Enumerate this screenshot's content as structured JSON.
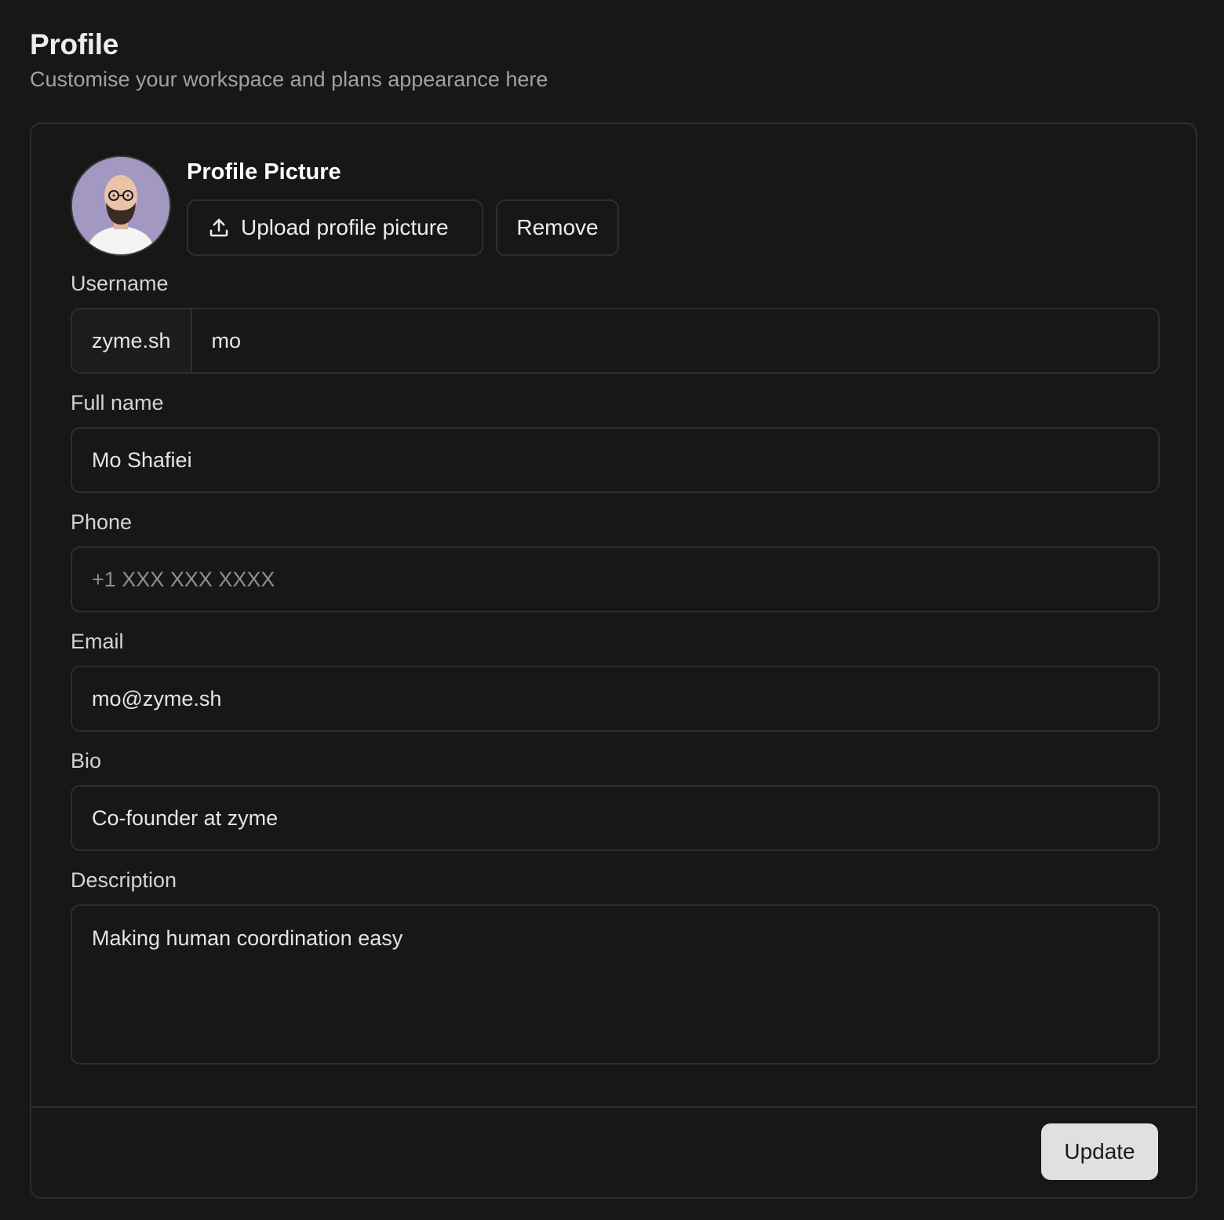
{
  "header": {
    "title": "Profile",
    "subtitle": "Customise your workspace and plans appearance here"
  },
  "profile_picture": {
    "heading": "Profile Picture",
    "upload_label": "Upload profile picture",
    "remove_label": "Remove",
    "upload_icon": "upload-icon"
  },
  "fields": {
    "username": {
      "label": "Username",
      "prefix": "zyme.sh",
      "value": "mo"
    },
    "full_name": {
      "label": "Full name",
      "value": "Mo Shafiei"
    },
    "phone": {
      "label": "Phone",
      "placeholder": "+1 XXX XXX XXXX"
    },
    "email": {
      "label": "Email",
      "value": "mo@zyme.sh"
    },
    "bio": {
      "label": "Bio",
      "value": "Co-founder at zyme"
    },
    "description": {
      "label": "Description",
      "value": "Making human coordination easy"
    }
  },
  "footer": {
    "update_label": "Update"
  },
  "colors": {
    "background": "#171717",
    "border": "#2e2e2e",
    "primary_button": "#e0e0e0",
    "avatar_bg": "#a298c2"
  }
}
